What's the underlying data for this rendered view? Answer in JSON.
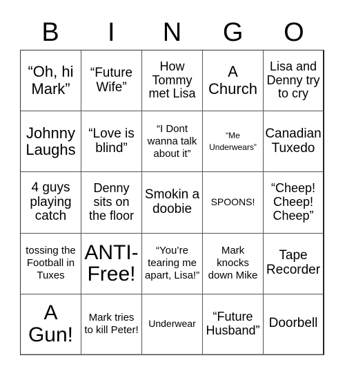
{
  "header": {
    "letters": [
      "B",
      "I",
      "N",
      "G",
      "O"
    ]
  },
  "cells": [
    [
      "“Oh, hi Mark”",
      "“Future Wife”",
      "How Tommy met Lisa",
      "A Church",
      "Lisa and Denny try to cry"
    ],
    [
      "Johnny Laughs",
      "“Love is blind”",
      "“I Dont wanna talk about it”",
      "“Me Underwears”",
      "Canadian Tuxedo"
    ],
    [
      "4 guys playing catch",
      "Denny sits on the floor",
      "Smokin a doobie",
      "SPOONS!",
      "“Cheep! Cheep! Cheep”"
    ],
    [
      "tossing the Football in Tuxes",
      "ANTI-Free!",
      "“You’re tearing me apart, Lisa!”",
      "Mark knocks down Mike",
      "Tape Recorder"
    ],
    [
      "A Gun!",
      "Mark tries to kill Peter!",
      "Underwear",
      "“Future Husband”",
      "Doorbell"
    ]
  ]
}
